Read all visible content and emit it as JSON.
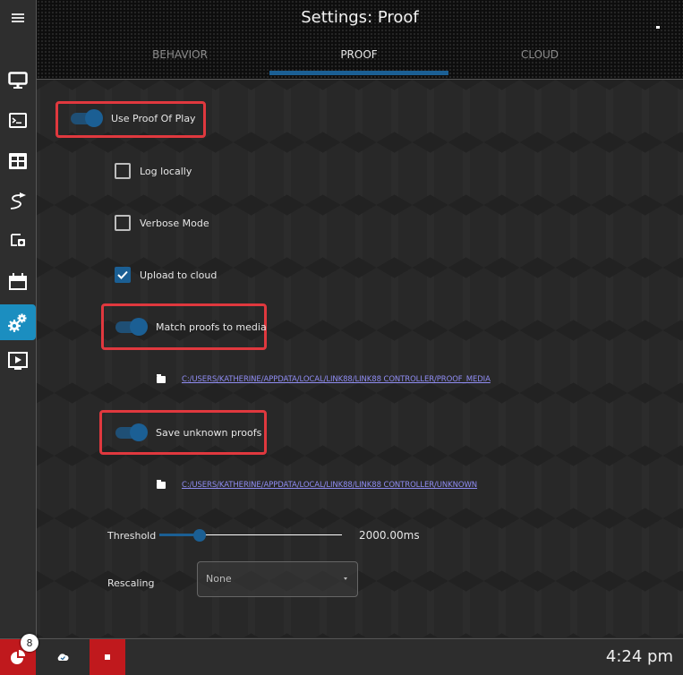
{
  "header": {
    "title": "Settings: Proof",
    "tabs": [
      {
        "label": "BEHAVIOR",
        "active": false
      },
      {
        "label": "PROOF",
        "active": true
      },
      {
        "label": "CLOUD",
        "active": false
      }
    ]
  },
  "sidebar": {
    "items": [
      {
        "icon": "menu-icon"
      },
      {
        "icon": "monitor-icon"
      },
      {
        "icon": "terminal-icon"
      },
      {
        "icon": "grid-icon"
      },
      {
        "icon": "route-icon"
      },
      {
        "icon": "screen-capture-icon"
      },
      {
        "icon": "calendar-icon"
      },
      {
        "icon": "gears-icon",
        "active": true
      },
      {
        "icon": "play-screen-icon"
      }
    ]
  },
  "settings": {
    "use_proof_of_play": {
      "label": "Use Proof Of Play",
      "on": true
    },
    "log_locally": {
      "label": "Log locally",
      "checked": false
    },
    "verbose_mode": {
      "label": "Verbose Mode",
      "checked": false
    },
    "upload_to_cloud": {
      "label": "Upload to cloud",
      "checked": true
    },
    "match_proofs_to_media": {
      "label": "Match proofs to media",
      "on": true
    },
    "proof_media_path": "C:/USERS/KATHERINE/APPDATA/LOCAL/LINK88/LINK88 CONTROLLER/PROOF_MEDIA",
    "save_unknown_proofs": {
      "label": "Save unknown proofs",
      "on": true
    },
    "unknown_path": "C:/USERS/KATHERINE/APPDATA/LOCAL/LINK88/LINK88 CONTROLLER/UNKNOWN",
    "threshold": {
      "label": "Threshold",
      "value_text": "2000.00ms",
      "fraction": 0.22
    },
    "rescaling": {
      "label": "Rescaling",
      "selected": "None"
    }
  },
  "footer": {
    "badge_count": "8",
    "time": "4:24 pm"
  },
  "colors": {
    "accent": "#1b5f94",
    "sidebar_active": "#1b8ec0",
    "highlight_box": "#e0383e",
    "footer_red": "#c0191d",
    "link": "#8f8cf2"
  }
}
